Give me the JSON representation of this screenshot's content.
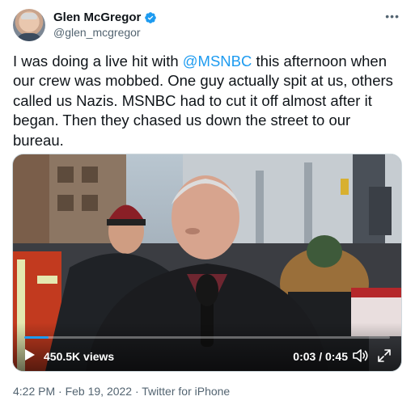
{
  "author": {
    "name": "Glen McGregor",
    "handle": "@glen_mcgregor",
    "avatar_icon": "profile-photo"
  },
  "more_label": "•••",
  "tweet": {
    "text_part1": "I was doing a live hit with ",
    "mention": "@MSNBC",
    "text_part2": " this afternoon when our crew was mobbed. One guy actually spit at us, others called us Nazis. MSNBC had to cut it off almost after it began. Then they chased us down the street to our bureau."
  },
  "video": {
    "views": "450.5K views",
    "time": "0:03 / 0:45",
    "progress": 0.067
  },
  "meta": {
    "timestamp": "4:22 PM · Feb 19, 2022 · Twitter for iPhone"
  },
  "colors": {
    "accent": "#1d9bf0",
    "text": "#0f1419",
    "secondary": "#536471"
  }
}
